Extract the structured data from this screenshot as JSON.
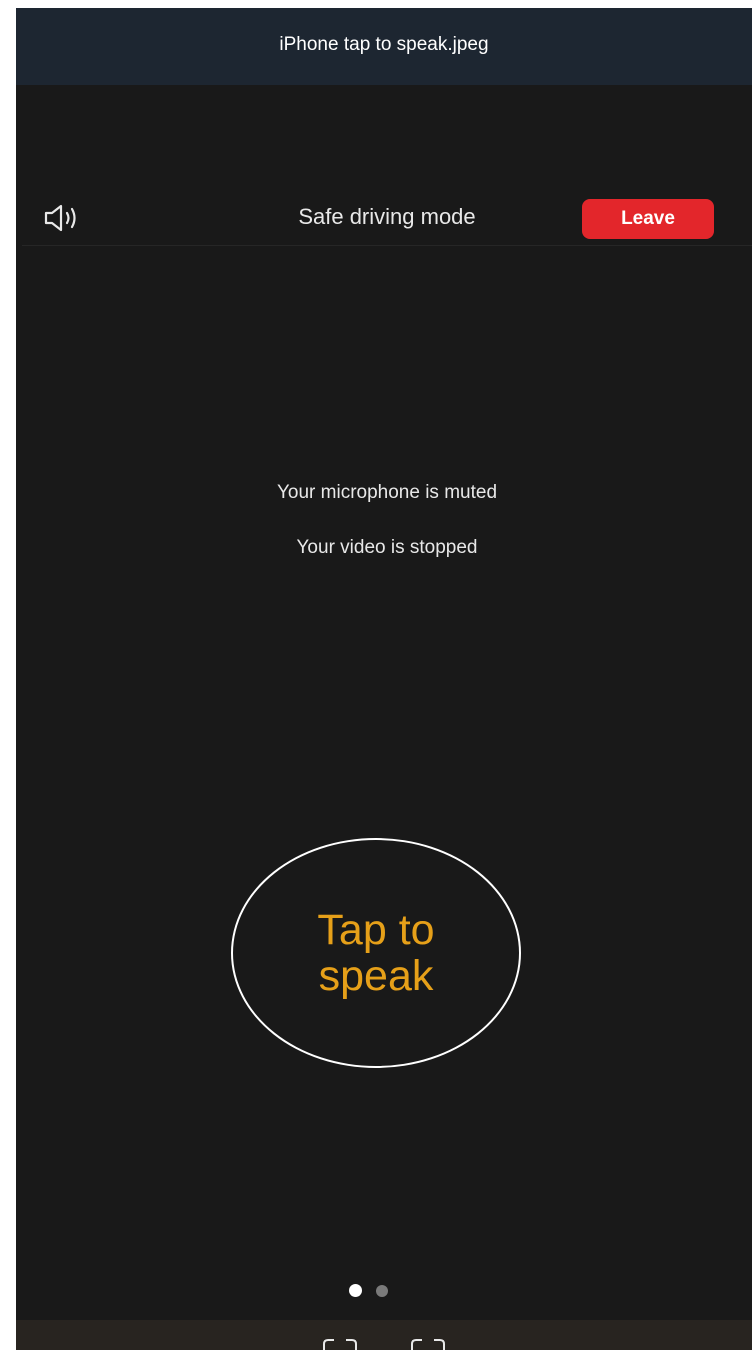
{
  "window": {
    "title": "iPhone tap to speak.jpeg"
  },
  "header": {
    "speaker_icon": "speaker-icon",
    "title": "Safe driving mode",
    "leave_label": "Leave",
    "leave_color": "#e3262b"
  },
  "status": {
    "microphone": "Your microphone is muted",
    "video": "Your video is stopped"
  },
  "tap_to_speak": {
    "label": "Tap to speak",
    "label_color": "#e6a019"
  },
  "pager": {
    "current_page": 1,
    "total_pages": 2
  },
  "toolbar": {
    "icons": [
      "expand-icon",
      "fullscreen-icon"
    ]
  }
}
